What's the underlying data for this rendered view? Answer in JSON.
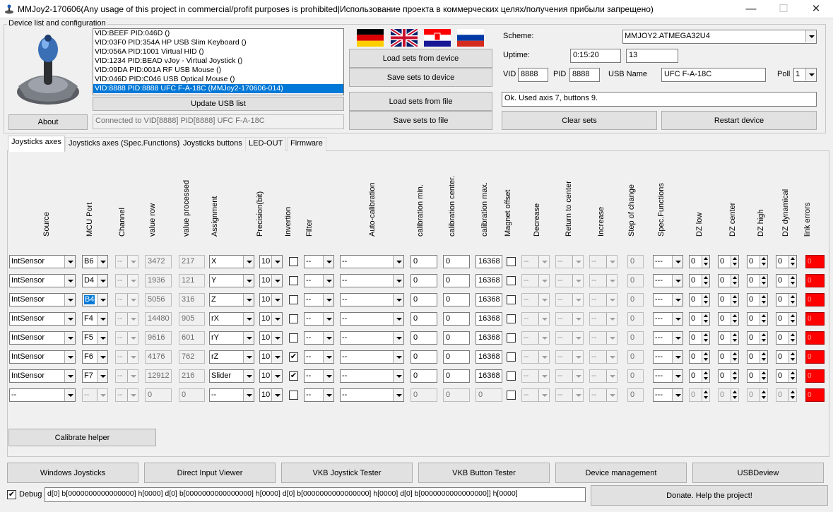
{
  "window": {
    "title": "MMJoy2-170606(Any usage of this project in commercial/profit purposes is prohibited|Использование проекта в коммерческих целях/получения прибыли запрещено)"
  },
  "device": {
    "group_caption": "Device list and configuration",
    "list": [
      "VID:BEEF PID:046D  ()",
      "VID:03F0 PID:354A HP USB Slim Keyboard ()",
      "VID:056A PID:1001 Virtual HID ()",
      "VID:1234 PID:BEAD vJoy - Virtual Joystick ()",
      "VID:09DA PID:001A RF USB Mouse ()",
      "VID:046D PID:C046 USB Optical Mouse ()",
      "VID:8888 PID:8888 UFC F-A-18C (MMJoy2-170606-014)"
    ],
    "about_label": "About",
    "update_label": "Update USB list",
    "connected_text": "Connected to VID[8888] PID[8888] UFC F-A-18C"
  },
  "sets": {
    "load_device": "Load sets from device",
    "save_device": "Save sets to device",
    "load_file": "Load sets from file",
    "save_file": "Save sets to file"
  },
  "flags": [
    "german-flag",
    "uk-flag",
    "croatian-flag",
    "russian-flag"
  ],
  "config": {
    "scheme_label": "Scheme:",
    "scheme_value": "MMJOY2.ATMEGA32U4",
    "uptime_label": "Uptime:",
    "uptime_value": "0:15:20",
    "uptime_count": "13",
    "vid_label": "VID",
    "vid_value": "8888",
    "pid_label": "PID",
    "pid_value": "8888",
    "usbname_label": "USB Name",
    "usbname_value": "UFC F-A-18C",
    "poll_label": "Poll",
    "poll_value": "1",
    "status": "Ok. Used axis  7, buttons 9.",
    "clear_label": "Clear sets",
    "restart_label": "Restart device"
  },
  "tabs": [
    "Joysticks axes",
    "Joysticks axes (Spec.Functions)",
    "Joysticks buttons",
    "LED-OUT",
    "Firmware"
  ],
  "columns": [
    "Source",
    "MCU Port",
    "Channel",
    "value row",
    "value processed",
    "Assignment",
    "Precision(bit)",
    "Invertion",
    "Filter",
    "Auto-calibration",
    "calibration min.",
    "calibration center.",
    "calibration max.",
    "Magnet offset",
    "Decrease",
    "Return to center",
    "Increase",
    "Step of change",
    "Spec.Functions",
    "DZ low",
    "DZ center",
    "DZ high",
    "DZ dynamical",
    "link errors"
  ],
  "rows": [
    {
      "source": "IntSensor",
      "port": "B6",
      "channel": "--",
      "raw": "3472",
      "proc": "217",
      "assign": "X",
      "prec": "10",
      "inv": "",
      "filter": "--",
      "auto": "--",
      "cmin": "0",
      "ccen": "0",
      "cmax": "16368",
      "dec": "--",
      "ret": "--",
      "inc": "--",
      "step": "0",
      "spec": "---",
      "dzl": "0",
      "dzc": "0",
      "dzh": "0",
      "dzd": "0",
      "err": "0"
    },
    {
      "source": "IntSensor",
      "port": "D4",
      "channel": "--",
      "raw": "1936",
      "proc": "121",
      "assign": "Y",
      "prec": "10",
      "inv": "",
      "filter": "--",
      "auto": "--",
      "cmin": "0",
      "ccen": "0",
      "cmax": "16368",
      "dec": "--",
      "ret": "--",
      "inc": "--",
      "step": "0",
      "spec": "---",
      "dzl": "0",
      "dzc": "0",
      "dzh": "0",
      "dzd": "0",
      "err": "0"
    },
    {
      "source": "IntSensor",
      "port": "B4",
      "channel": "--",
      "raw": "5056",
      "proc": "316",
      "assign": "Z",
      "prec": "10",
      "inv": "",
      "filter": "--",
      "auto": "--",
      "cmin": "0",
      "ccen": "0",
      "cmax": "16368",
      "dec": "--",
      "ret": "--",
      "inc": "--",
      "step": "0",
      "spec": "---",
      "dzl": "0",
      "dzc": "0",
      "dzh": "0",
      "dzd": "0",
      "err": "0"
    },
    {
      "source": "IntSensor",
      "port": "F4",
      "channel": "--",
      "raw": "14480",
      "proc": "905",
      "assign": "rX",
      "prec": "10",
      "inv": "",
      "filter": "--",
      "auto": "--",
      "cmin": "0",
      "ccen": "0",
      "cmax": "16368",
      "dec": "--",
      "ret": "--",
      "inc": "--",
      "step": "0",
      "spec": "---",
      "dzl": "0",
      "dzc": "0",
      "dzh": "0",
      "dzd": "0",
      "err": "0"
    },
    {
      "source": "IntSensor",
      "port": "F5",
      "channel": "--",
      "raw": "9616",
      "proc": "601",
      "assign": "rY",
      "prec": "10",
      "inv": "",
      "filter": "--",
      "auto": "--",
      "cmin": "0",
      "ccen": "0",
      "cmax": "16368",
      "dec": "--",
      "ret": "--",
      "inc": "--",
      "step": "0",
      "spec": "---",
      "dzl": "0",
      "dzc": "0",
      "dzh": "0",
      "dzd": "0",
      "err": "0"
    },
    {
      "source": "IntSensor",
      "port": "F6",
      "channel": "--",
      "raw": "4176",
      "proc": "762",
      "assign": "rZ",
      "prec": "10",
      "inv": "✔",
      "filter": "--",
      "auto": "--",
      "cmin": "0",
      "ccen": "0",
      "cmax": "16368",
      "dec": "--",
      "ret": "--",
      "inc": "--",
      "step": "0",
      "spec": "---",
      "dzl": "0",
      "dzc": "0",
      "dzh": "0",
      "dzd": "0",
      "err": "0"
    },
    {
      "source": "IntSensor",
      "port": "F7",
      "channel": "--",
      "raw": "12912",
      "proc": "216",
      "assign": "Slider",
      "prec": "10",
      "inv": "✔",
      "filter": "--",
      "auto": "--",
      "cmin": "0",
      "ccen": "0",
      "cmax": "16368",
      "dec": "--",
      "ret": "--",
      "inc": "--",
      "step": "0",
      "spec": "---",
      "dzl": "0",
      "dzc": "0",
      "dzh": "0",
      "dzd": "0",
      "err": "0"
    },
    {
      "source": "--",
      "port": "--",
      "channel": "--",
      "raw": "0",
      "proc": "0",
      "assign": "--",
      "prec": "10",
      "inv": "",
      "filter": "--",
      "auto": "--",
      "cmin": "0",
      "ccen": "0",
      "cmax": "0",
      "dec": "--",
      "ret": "--",
      "inc": "--",
      "step": "0",
      "spec": "---",
      "dzl": "0",
      "dzc": "0",
      "dzh": "0",
      "dzd": "0",
      "err": "0"
    }
  ],
  "calibrate_label": "Calibrate helper",
  "bottom_buttons": [
    "Windows Joysticks",
    "Direct Input Viewer",
    "VKB Joystick Tester",
    "VKB Button Tester",
    "Device management",
    "USBDeview"
  ],
  "debug": {
    "label": "Debug",
    "checked": "✔",
    "text": "d[0] b[0000000000000000] h[0000]   d[0] b[0000000000000000] h[0000]   d[0] b[0000000000000000] h[0000]   d[0] b[0000000000000000]] h[0000]"
  },
  "donate_label": "Donate. Help the project!"
}
